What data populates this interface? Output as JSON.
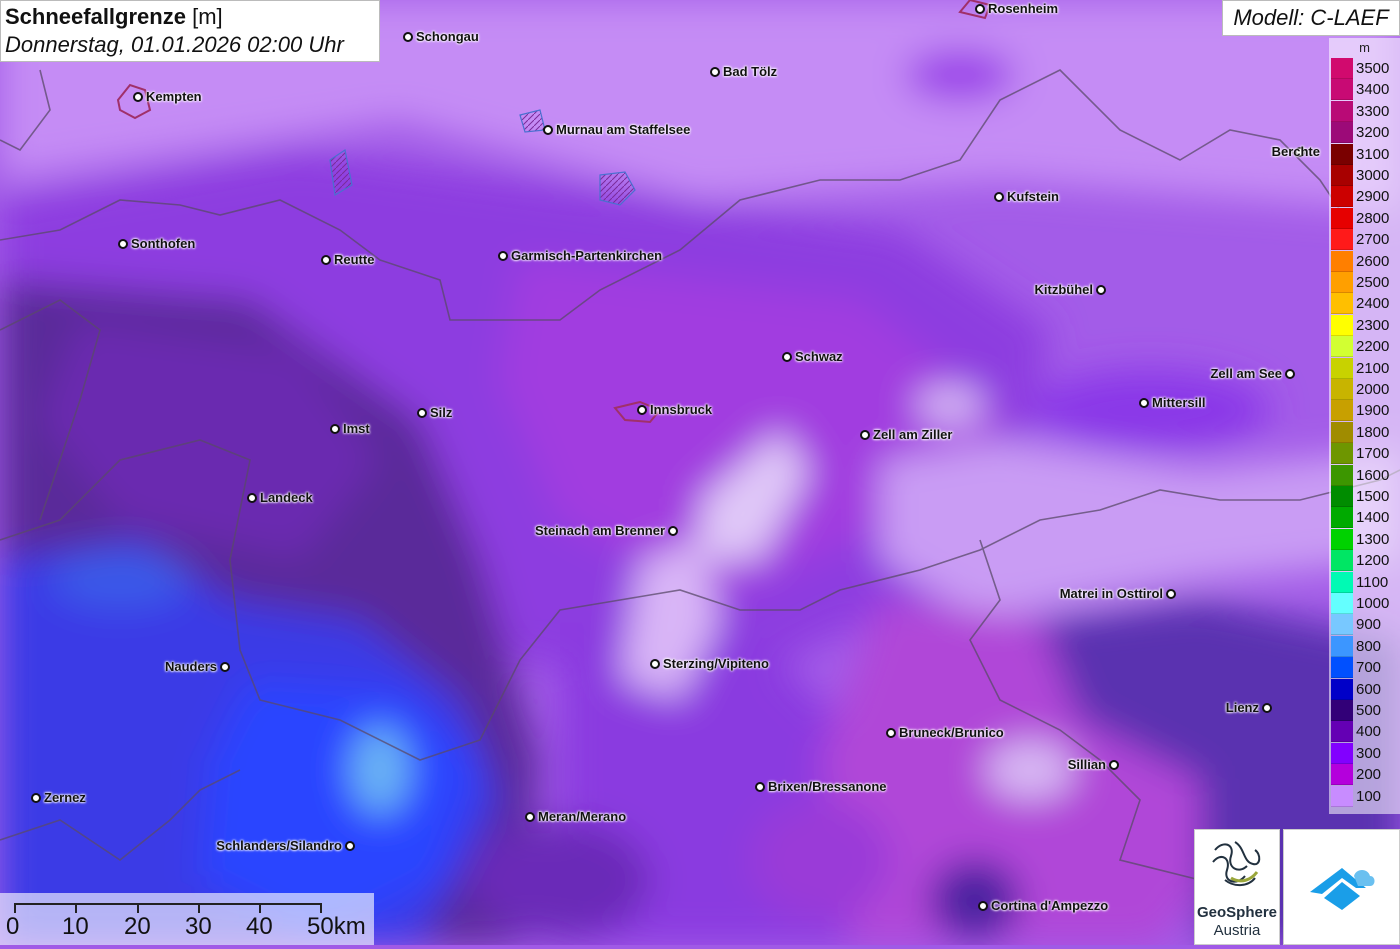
{
  "title": {
    "main": "Schneefallgrenze",
    "unit": "[m]",
    "date": "Donnerstag, 01.01.2026 02:00 Uhr"
  },
  "model": "Modell: C-LAEF",
  "legend": {
    "unit": "m",
    "items": [
      {
        "value": "3500",
        "color": "#d10a6e"
      },
      {
        "value": "3400",
        "color": "#c80a74"
      },
      {
        "value": "3300",
        "color": "#b90a76"
      },
      {
        "value": "3200",
        "color": "#9c0a78"
      },
      {
        "value": "3100",
        "color": "#7a0000"
      },
      {
        "value": "3000",
        "color": "#a80000"
      },
      {
        "value": "2900",
        "color": "#cc0000"
      },
      {
        "value": "2800",
        "color": "#e60000"
      },
      {
        "value": "2700",
        "color": "#ff1a1a"
      },
      {
        "value": "2600",
        "color": "#ff7f00"
      },
      {
        "value": "2500",
        "color": "#ff9f00"
      },
      {
        "value": "2400",
        "color": "#ffbf00"
      },
      {
        "value": "2300",
        "color": "#ffff00"
      },
      {
        "value": "2200",
        "color": "#d2ff32"
      },
      {
        "value": "2100",
        "color": "#c8d200"
      },
      {
        "value": "2000",
        "color": "#c8b400"
      },
      {
        "value": "1900",
        "color": "#c8a000"
      },
      {
        "value": "1800",
        "color": "#a08c00"
      },
      {
        "value": "1700",
        "color": "#6e9600"
      },
      {
        "value": "1600",
        "color": "#3c9600"
      },
      {
        "value": "1500",
        "color": "#008c00"
      },
      {
        "value": "1400",
        "color": "#00aa00"
      },
      {
        "value": "1300",
        "color": "#00d200"
      },
      {
        "value": "1200",
        "color": "#00e664"
      },
      {
        "value": "1100",
        "color": "#00fab4"
      },
      {
        "value": "1000",
        "color": "#64ffff"
      },
      {
        "value": "900",
        "color": "#78c8ff"
      },
      {
        "value": "800",
        "color": "#3c96ff"
      },
      {
        "value": "700",
        "color": "#0050ff"
      },
      {
        "value": "600",
        "color": "#0000c8"
      },
      {
        "value": "500",
        "color": "#320078"
      },
      {
        "value": "400",
        "color": "#6400b4"
      },
      {
        "value": "300",
        "color": "#8200ff"
      },
      {
        "value": "200",
        "color": "#b400dc"
      },
      {
        "value": "100",
        "color": "#c88cff"
      }
    ]
  },
  "scale": {
    "labels": [
      "0",
      "10",
      "20",
      "30",
      "40",
      "50km"
    ]
  },
  "logo": {
    "line1": "GeoSphere",
    "line2": "Austria"
  },
  "cities": [
    {
      "name": "Rosenheim",
      "side": "right"
    },
    {
      "name": "Schongau",
      "side": "right"
    },
    {
      "name": "Kempten",
      "side": "right"
    },
    {
      "name": "Bad Tölz",
      "side": "right"
    },
    {
      "name": "Murnau am Staffelsee",
      "side": "right"
    },
    {
      "name": "Berchte",
      "side": "right"
    },
    {
      "name": "Kufstein",
      "side": "right"
    },
    {
      "name": "Sonthofen",
      "side": "right"
    },
    {
      "name": "Reutte",
      "side": "right"
    },
    {
      "name": "Garmisch-Partenkirchen",
      "side": "right"
    },
    {
      "name": "Kitzbühel",
      "side": "left"
    },
    {
      "name": "Schwaz",
      "side": "right"
    },
    {
      "name": "Zell am See",
      "side": "left"
    },
    {
      "name": "Mittersill",
      "side": "right"
    },
    {
      "name": "Innsbruck",
      "side": "right"
    },
    {
      "name": "Silz",
      "side": "right"
    },
    {
      "name": "Imst",
      "side": "right"
    },
    {
      "name": "Zell am Ziller",
      "side": "right"
    },
    {
      "name": "Landeck",
      "side": "right"
    },
    {
      "name": "Steinach am Brenner",
      "side": "left"
    },
    {
      "name": "Matrei in Osttirol",
      "side": "left"
    },
    {
      "name": "Nauders",
      "side": "left"
    },
    {
      "name": "Sterzing/Vipiteno",
      "side": "right"
    },
    {
      "name": "Lienz",
      "side": "left"
    },
    {
      "name": "Bruneck/Brunico",
      "side": "right"
    },
    {
      "name": "Sillian",
      "side": "left"
    },
    {
      "name": "Brixen/Bressanone",
      "side": "right"
    },
    {
      "name": "Zernez",
      "side": "right"
    },
    {
      "name": "Meran/Merano",
      "side": "right"
    },
    {
      "name": "Schlanders/Silandro",
      "side": "left"
    },
    {
      "name": "Cortina d'Ampezzo",
      "side": "right"
    }
  ]
}
